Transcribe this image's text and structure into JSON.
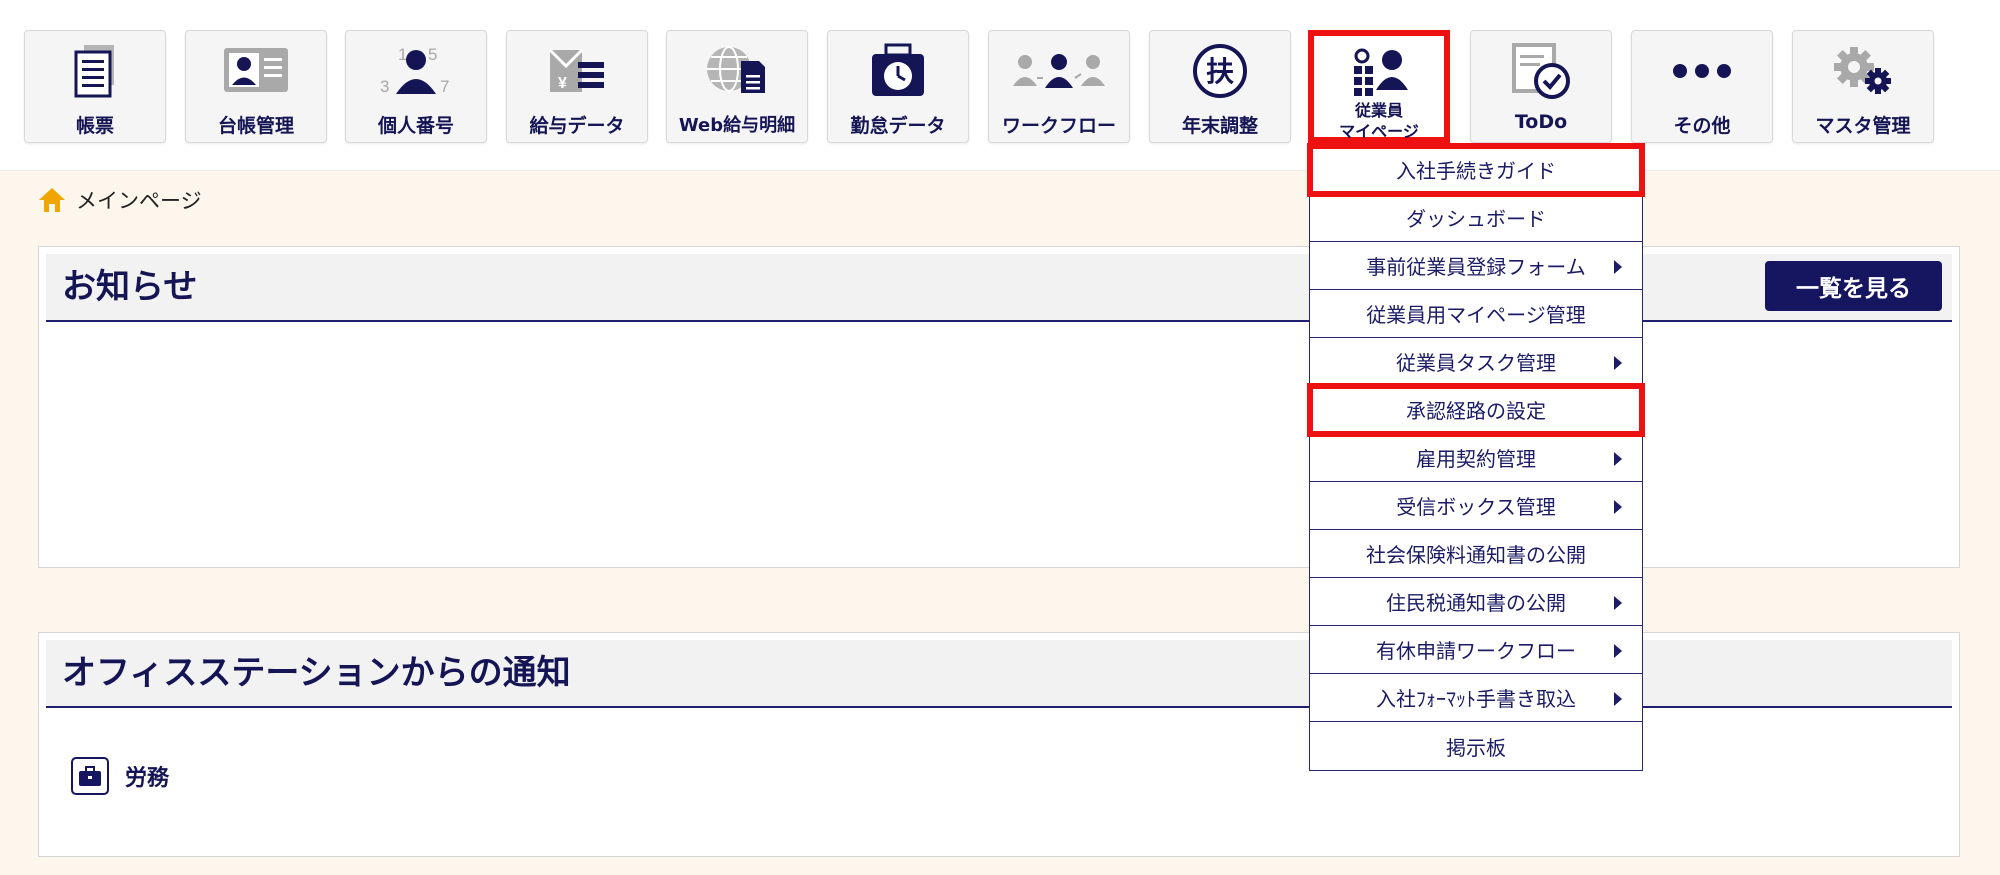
{
  "nav": {
    "tiles": [
      {
        "label": "帳票",
        "icon": "document-stack-icon"
      },
      {
        "label": "台帳管理",
        "icon": "id-card-icon"
      },
      {
        "label": "個人番号",
        "icon": "person-number-icon"
      },
      {
        "label": "給与データ",
        "icon": "yen-list-icon"
      },
      {
        "label": "Web給与明細",
        "icon": "globe-document-icon"
      },
      {
        "label": "勤怠データ",
        "icon": "clock-card-icon"
      },
      {
        "label": "ワークフロー",
        "icon": "people-flow-icon"
      },
      {
        "label": "年末調整",
        "icon": "fu-seal-icon"
      },
      {
        "label_line1": "従業員",
        "label_line2": "マイページ",
        "icon": "employee-grid-icon",
        "active": true
      },
      {
        "label": "ToDo",
        "icon": "todo-check-icon"
      },
      {
        "label": "その他",
        "icon": "more-dots-icon"
      },
      {
        "label": "マスタ管理",
        "icon": "gears-icon"
      }
    ]
  },
  "breadcrumb": {
    "home_icon": "home-icon",
    "label": "メインページ"
  },
  "notices": {
    "title": "お知らせ",
    "view_all_label": "一覧を見る"
  },
  "office_station": {
    "title": "オフィスステーションからの通知",
    "category_icon": "briefcase-icon",
    "category_label": "労務"
  },
  "dropdown": {
    "items": [
      {
        "label": "入社手続きガイド",
        "submenu": false,
        "highlighted": true
      },
      {
        "label": "ダッシュボード",
        "submenu": false
      },
      {
        "label": "事前従業員登録フォーム",
        "submenu": true
      },
      {
        "label": "従業員用マイページ管理",
        "submenu": false
      },
      {
        "label": "従業員タスク管理",
        "submenu": true
      },
      {
        "label": "承認経路の設定",
        "submenu": false,
        "highlighted": true
      },
      {
        "label": "雇用契約管理",
        "submenu": true
      },
      {
        "label": "受信ボックス管理",
        "submenu": true
      },
      {
        "label": "社会保険料通知書の公開",
        "submenu": false
      },
      {
        "label": "住民税通知書の公開",
        "submenu": true
      },
      {
        "label": "有休申請ワークフロー",
        "submenu": true
      },
      {
        "label": "入社ﾌｫｰﾏｯﾄ手書き取込",
        "submenu": true
      },
      {
        "label": "掲示板",
        "submenu": false
      }
    ]
  },
  "colors": {
    "navy": "#151555",
    "highlight": "#ee1111",
    "page_bg": "#fdf6ec",
    "icon_gray": "#a9a9a9"
  }
}
